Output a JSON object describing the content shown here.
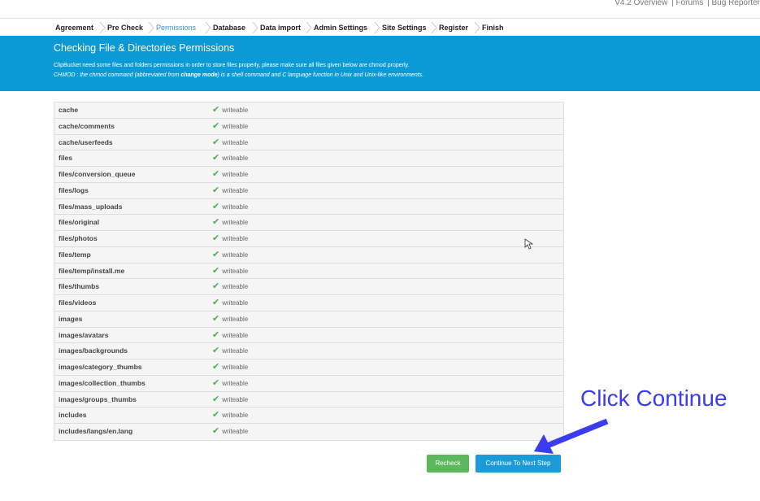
{
  "top_links": [
    "V4.2 Overview",
    "| Forums",
    "| Bug Reporter"
  ],
  "steps": [
    {
      "label": "Agreement",
      "active": false
    },
    {
      "label": "Pre Check",
      "active": false
    },
    {
      "label": "Permissions",
      "active": true
    },
    {
      "label": "Database",
      "active": false
    },
    {
      "label": "Data import",
      "active": false
    },
    {
      "label": "Admin Settings",
      "active": false
    },
    {
      "label": "Site Settings",
      "active": false
    },
    {
      "label": "Register",
      "active": false
    },
    {
      "label": "Finish",
      "active": false
    }
  ],
  "banner": {
    "title": "Checking File & Directories Permissions",
    "line1": "ClipBucket need some files and folders permissions in order to store files properly, please make sure all files given below are chmod properly.",
    "line2_prefix": "CHMOD : the chmod command (abbreviated from ",
    "line2_bold": "change mode",
    "line2_suffix": ") is a shell command and C language function in Unix and Unix-like environments."
  },
  "permissions": [
    {
      "path": "cache",
      "status": "writeable"
    },
    {
      "path": "cache/comments",
      "status": "writeable"
    },
    {
      "path": "cache/userfeeds",
      "status": "writeable"
    },
    {
      "path": "files",
      "status": "writeable"
    },
    {
      "path": "files/conversion_queue",
      "status": "writeable"
    },
    {
      "path": "files/logs",
      "status": "writeable"
    },
    {
      "path": "files/mass_uploads",
      "status": "writeable"
    },
    {
      "path": "files/original",
      "status": "writeable"
    },
    {
      "path": "files/photos",
      "status": "writeable"
    },
    {
      "path": "files/temp",
      "status": "writeable"
    },
    {
      "path": "files/temp/install.me",
      "status": "writeable"
    },
    {
      "path": "files/thumbs",
      "status": "writeable"
    },
    {
      "path": "files/videos",
      "status": "writeable"
    },
    {
      "path": "images",
      "status": "writeable"
    },
    {
      "path": "images/avatars",
      "status": "writeable"
    },
    {
      "path": "images/backgrounds",
      "status": "writeable"
    },
    {
      "path": "images/category_thumbs",
      "status": "writeable"
    },
    {
      "path": "images/collection_thumbs",
      "status": "writeable"
    },
    {
      "path": "images/groups_thumbs",
      "status": "writeable"
    },
    {
      "path": "includes",
      "status": "writeable"
    },
    {
      "path": "includes/langs/en.lang",
      "status": "writeable"
    }
  ],
  "buttons": {
    "recheck": "Recheck",
    "continue": "Continue To Next Step"
  },
  "annotation": {
    "text": "Click Continue",
    "color": "#3b3bf0"
  },
  "colors": {
    "banner": "#0a9ad5",
    "recheck": "#5cb85c",
    "continue": "#1a9ad6",
    "check": "#4caf50"
  }
}
